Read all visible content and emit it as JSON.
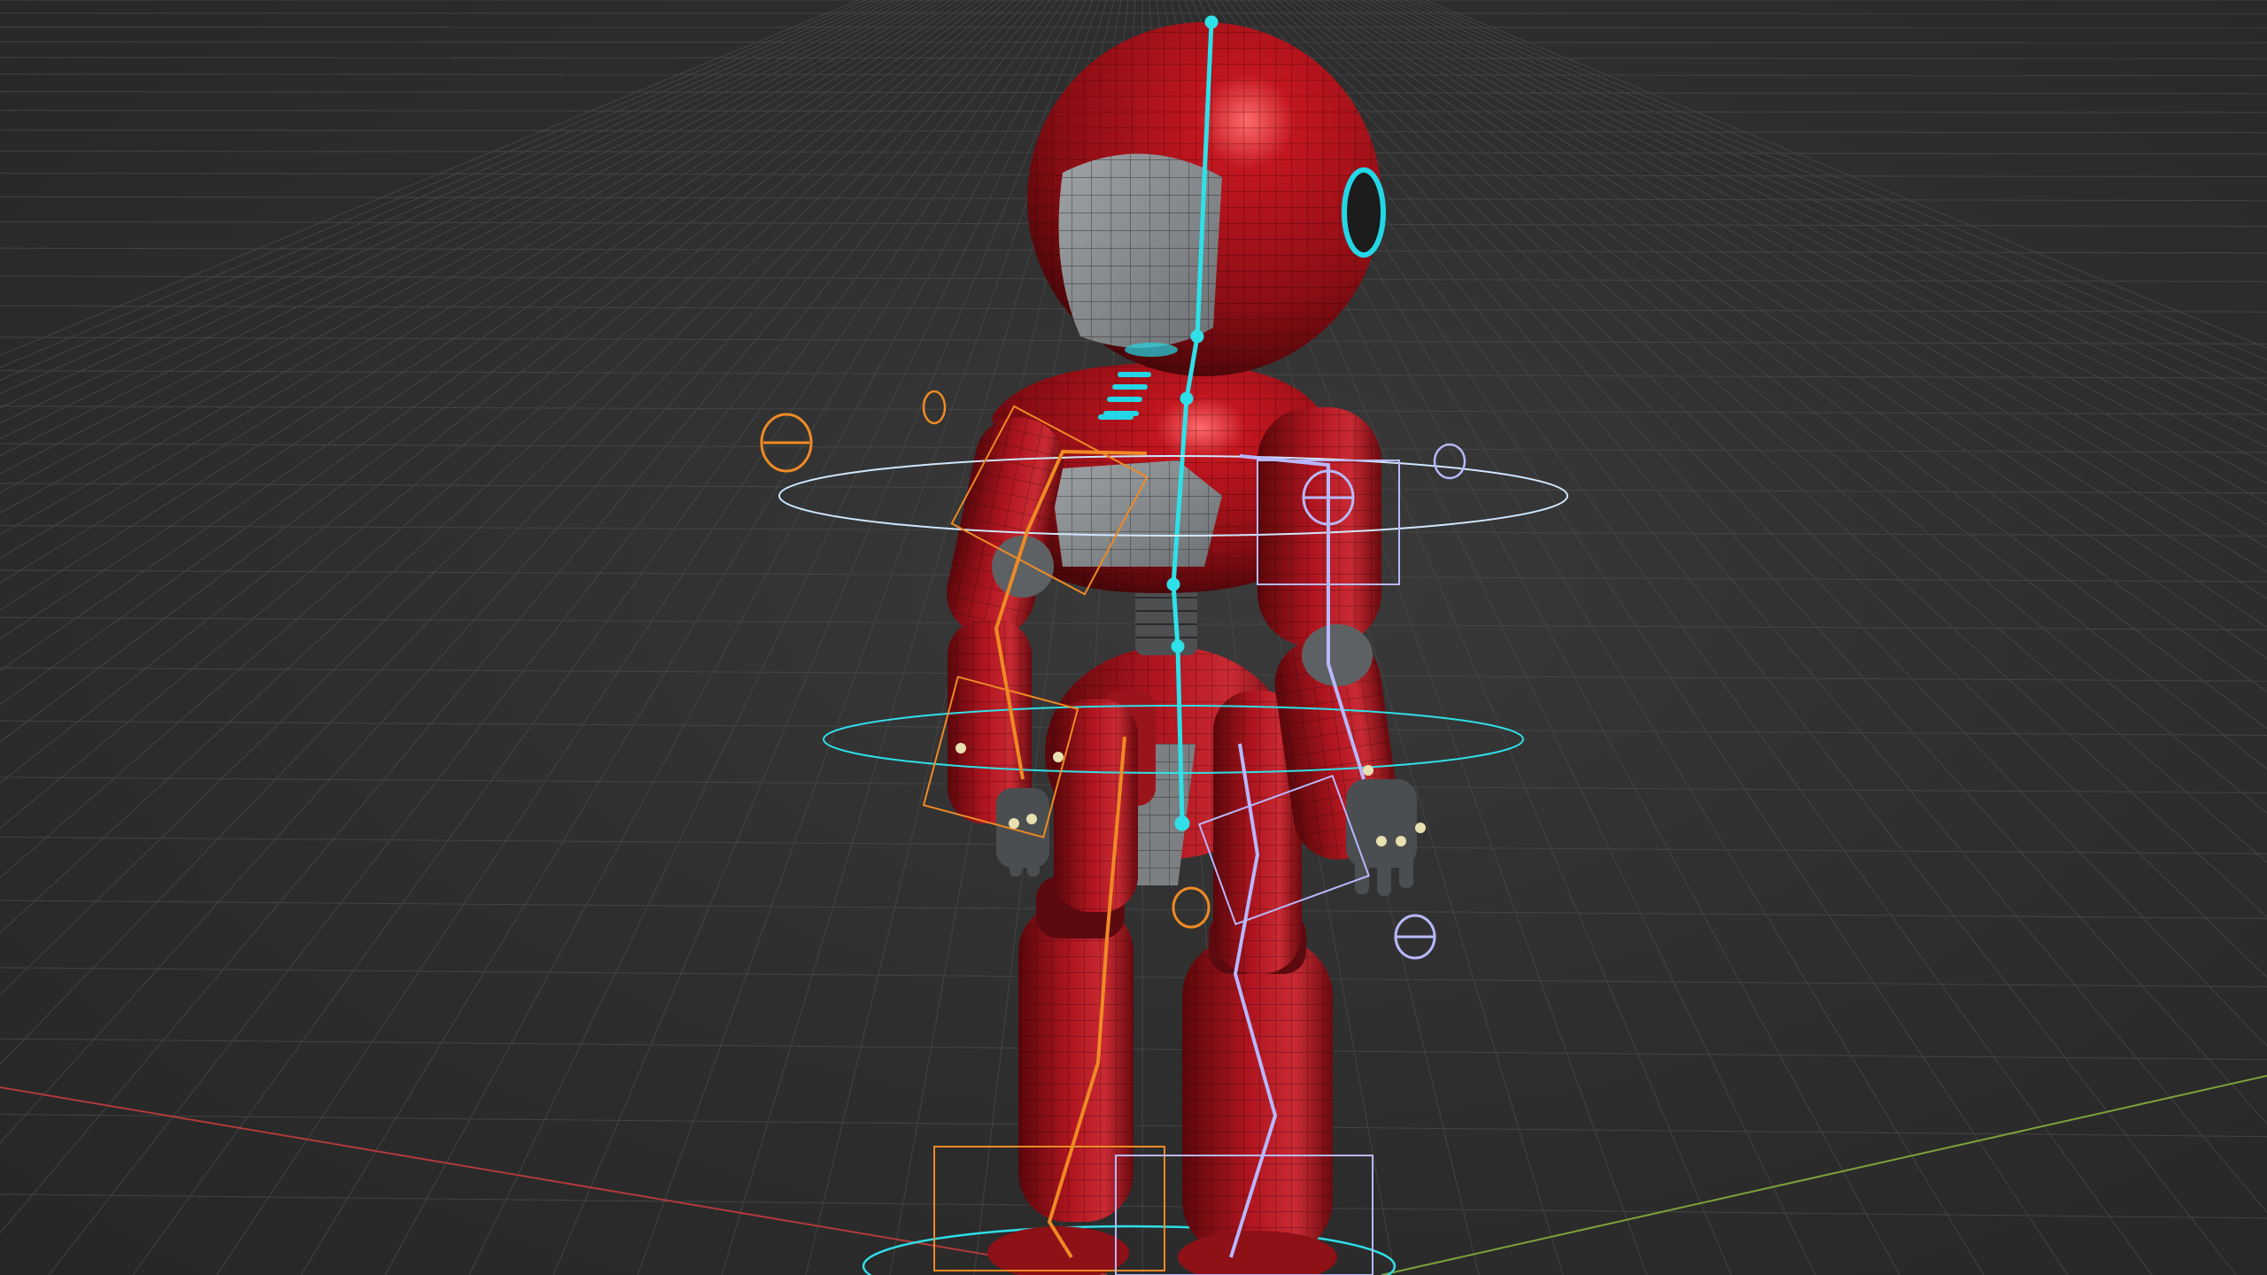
{
  "viewport": {
    "background": "#2f2f2f",
    "grid_color": "#4a4a4a",
    "x_axis_color": "#b13a3a",
    "y_axis_color": "#7da23a"
  },
  "model": {
    "body_color": "#a8141c",
    "body_dark": "#6e0b10",
    "face_color": "#8a8d8f",
    "accent_glow": "#23d7e6",
    "wire_color": "#1a0606"
  },
  "rig": {
    "spine_color": "#2fe0e8",
    "left_chain_color": "#f08a24",
    "right_chain_color": "#b8b8ff",
    "ring_color": "#cfe7ff"
  }
}
